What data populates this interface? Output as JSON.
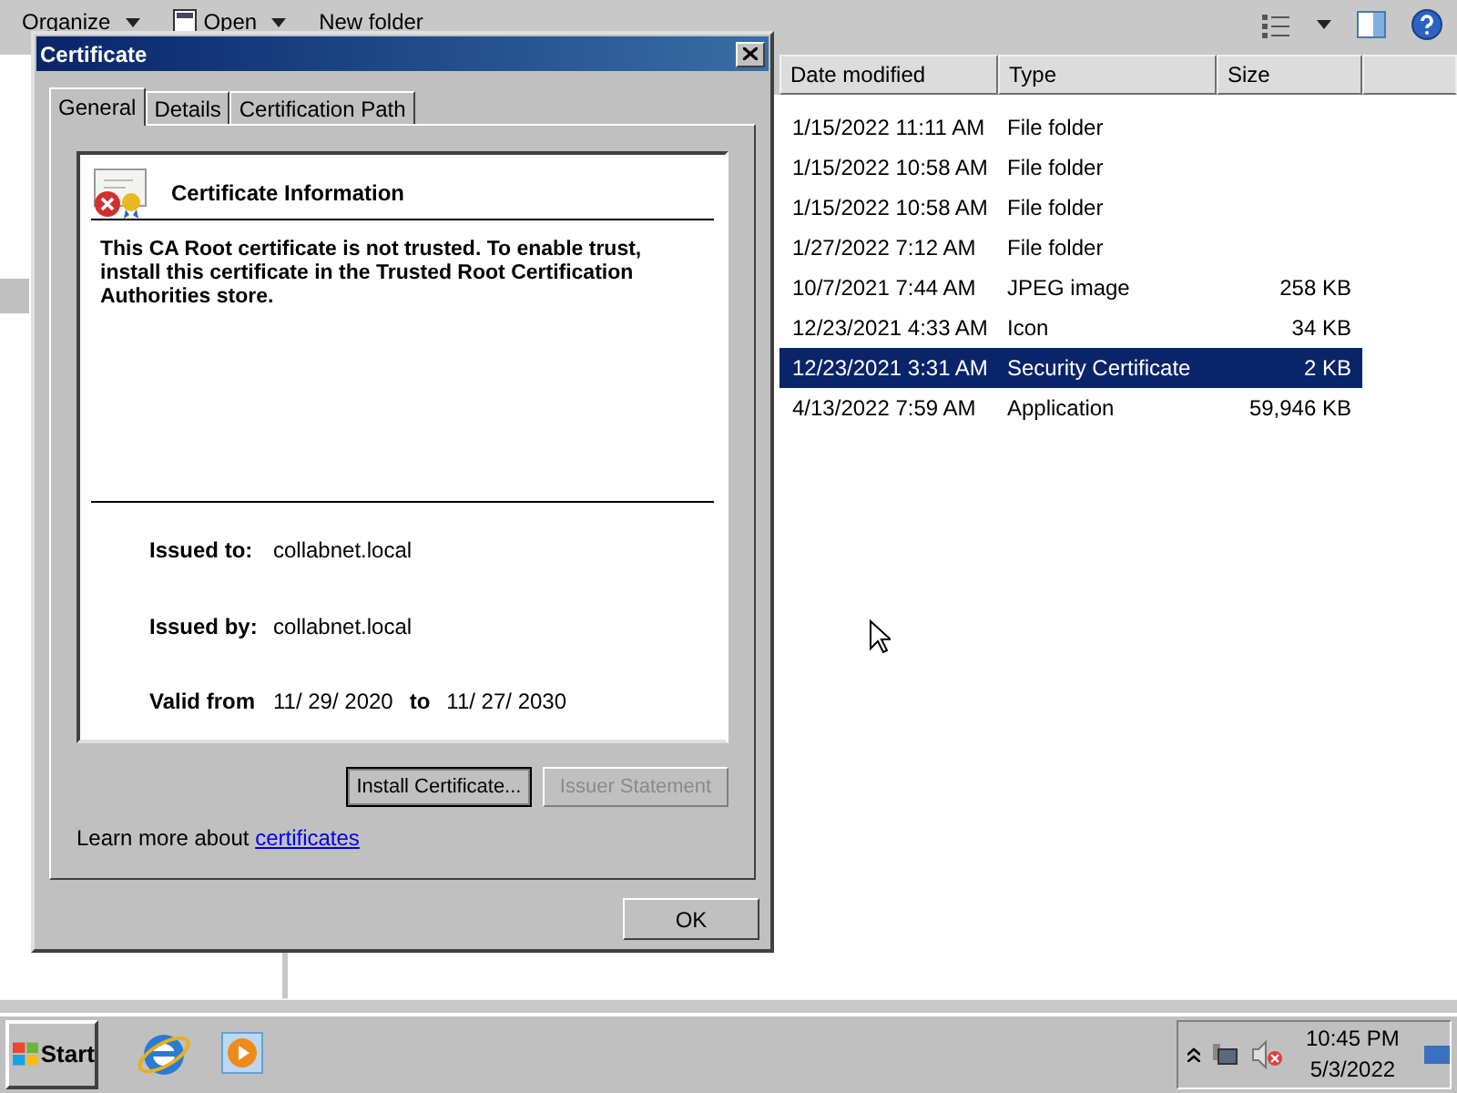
{
  "explorer": {
    "toolbar": [
      {
        "label": "Organize",
        "dropdown": true
      },
      {
        "label": "Open",
        "dropdown": true
      },
      {
        "label": "New folder",
        "dropdown": false
      }
    ],
    "columns": [
      "Date modified",
      "Type",
      "Size"
    ],
    "rows": [
      {
        "date": "1/15/2022 11:11 AM",
        "type": "File folder",
        "size": "",
        "selected": false
      },
      {
        "date": "1/15/2022 10:58 AM",
        "type": "File folder",
        "size": "",
        "selected": false
      },
      {
        "date": "1/15/2022 10:58 AM",
        "type": "File folder",
        "size": "",
        "selected": false
      },
      {
        "date": "1/27/2022 7:12 AM",
        "type": "File folder",
        "size": "",
        "selected": false
      },
      {
        "date": "10/7/2021 7:44 AM",
        "type": "JPEG image",
        "size": "258 KB",
        "selected": false
      },
      {
        "date": "12/23/2021 4:33 AM",
        "type": "Icon",
        "size": "34 KB",
        "selected": false
      },
      {
        "date": "12/23/2021 3:31 AM",
        "type": "Security Certificate",
        "size": "2 KB",
        "selected": true
      },
      {
        "date": "4/13/2022 7:59 AM",
        "type": "Application",
        "size": "59,946 KB",
        "selected": false
      }
    ]
  },
  "dialog": {
    "title": "Certificate",
    "tabs": [
      {
        "label": "General",
        "selected": true
      },
      {
        "label": "Details",
        "selected": false
      },
      {
        "label": "Certification Path",
        "selected": false
      }
    ],
    "heading": "Certificate Information",
    "message": "This CA Root certificate is not trusted. To enable trust, install this certificate in the Trusted Root Certification Authorities store.",
    "fields": [
      {
        "label": "Issued to:",
        "value": "collabnet.local"
      },
      {
        "label": "Issued by:",
        "value": "collabnet.local"
      }
    ],
    "valid": {
      "label": "Valid from",
      "from": "11/ 29/ 2020",
      "to_label": "to",
      "to": "11/ 27/ 2030"
    },
    "buttons": [
      {
        "label": "Install Certificate...",
        "disabled": false
      },
      {
        "label": "Issuer Statement",
        "disabled": true
      }
    ],
    "learn_more": {
      "text": "Learn more about",
      "link": "certificates"
    },
    "ok": "OK"
  },
  "taskbar": {
    "start": "Start",
    "time": "10:45 PM",
    "date": "5/3/2022"
  }
}
